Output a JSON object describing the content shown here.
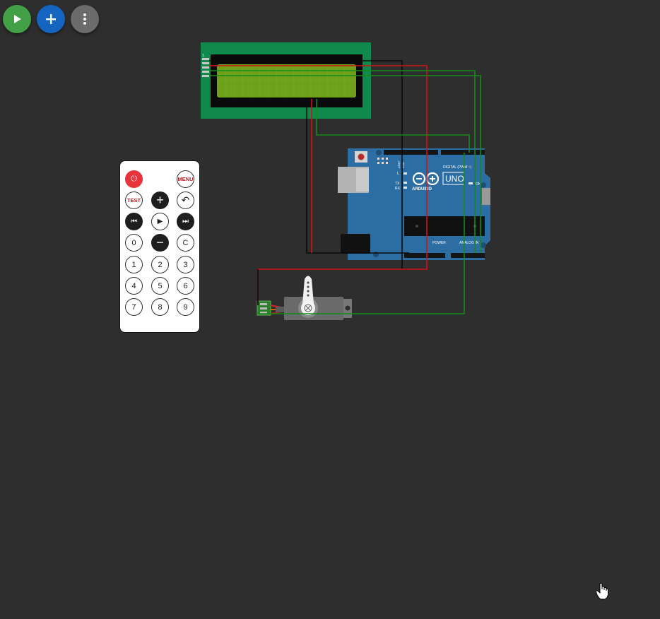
{
  "toolbar": {
    "run": {
      "label": "Start simulation",
      "icon": "play-icon",
      "color": "#43a047"
    },
    "add": {
      "label": "Add part",
      "icon": "plus-icon",
      "color": "#1565c0"
    },
    "more": {
      "label": "More options",
      "icon": "more-vertical-icon",
      "color": "#6b6b6b"
    }
  },
  "colors": {
    "canvas_bg": "#2e2e2e",
    "wire_green": "#178a17",
    "wire_red": "#d31212",
    "wire_black": "#0a0a0a",
    "lcd_pcb": "#0f8a4c",
    "lcd_screen": "#6ea01a",
    "arduino_blue": "#2c6ea3"
  },
  "arduino": {
    "brand": "ARDUINO",
    "model": "UNO",
    "digital_label": "DIGITAL (PWM ~)",
    "power_label": "POWER",
    "analog_label": "ANALOG IN",
    "tx": "TX",
    "rx": "RX",
    "l": "L",
    "on": "ON",
    "aref": "AREF",
    "gnd": "GND"
  },
  "lcd": {
    "pin_labels": [
      "1"
    ]
  },
  "remote": {
    "rows": [
      [
        {
          "name": "power",
          "label": "⏻",
          "style": "red"
        },
        {
          "name": "blank",
          "label": "",
          "style": "none"
        },
        {
          "name": "menu",
          "label": "MENU",
          "style": "redtxt"
        }
      ],
      [
        {
          "name": "test",
          "label": "TEST",
          "style": "redtxt"
        },
        {
          "name": "plus",
          "label": "+",
          "style": "dark"
        },
        {
          "name": "back",
          "label": "↶",
          "style": "plain"
        }
      ],
      [
        {
          "name": "prev",
          "label": "⏮",
          "style": "dark"
        },
        {
          "name": "play",
          "label": "▶",
          "style": "plain"
        },
        {
          "name": "next",
          "label": "⏭",
          "style": "dark"
        }
      ],
      [
        {
          "name": "0",
          "label": "0",
          "style": "plain"
        },
        {
          "name": "minus",
          "label": "−",
          "style": "dark"
        },
        {
          "name": "c",
          "label": "C",
          "style": "plain"
        }
      ],
      [
        {
          "name": "1",
          "label": "1",
          "style": "plain"
        },
        {
          "name": "2",
          "label": "2",
          "style": "plain"
        },
        {
          "name": "3",
          "label": "3",
          "style": "plain"
        }
      ],
      [
        {
          "name": "4",
          "label": "4",
          "style": "plain"
        },
        {
          "name": "5",
          "label": "5",
          "style": "plain"
        },
        {
          "name": "6",
          "label": "6",
          "style": "plain"
        }
      ],
      [
        {
          "name": "7",
          "label": "7",
          "style": "plain"
        },
        {
          "name": "8",
          "label": "8",
          "style": "plain"
        },
        {
          "name": "9",
          "label": "9",
          "style": "plain"
        }
      ]
    ]
  }
}
